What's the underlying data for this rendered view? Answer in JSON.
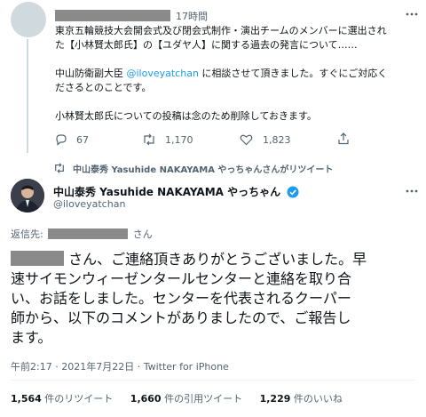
{
  "colors": {
    "accent": "#1d9bf0",
    "verified": "#1d9bf0",
    "text": "#0f1419",
    "secondary": "#536471",
    "redaction": "#8a8a8a"
  },
  "quoted_tweet": {
    "time": "17時間",
    "body_line1": "東京五輪競技大会開会式及び閉会式制作・演出チームのメンバーに選出され",
    "body_line2": "た【小林賢太郎氏】の【ユダヤ人】に関する過去の発言について……",
    "body_line3_before": "中山防衛副大臣",
    "body_line3_mention": "@iloveyatchan",
    "body_line3_after": "に相談させて頂きました。すぐにご対応く",
    "body_line4": "ださるとのことです。",
    "body_line5": "小林賢太郎氏についての投稿は念のため削除しておきます。",
    "replies": "67",
    "retweets": "1,170",
    "likes": "1,823",
    "menu_icon": "more-icon"
  },
  "retweet_notice": "中山泰秀 Yasuhide NAKAYAMA やっちゃんさんがリツイート",
  "author": {
    "display_name": "中山泰秀 Yasuhide NAKAYAMA やっちゃん",
    "handle": "@iloveyatchan",
    "verified": true
  },
  "reply_to_prefix": "返信先:",
  "reply_to_suffix": "さん",
  "tweet": {
    "line1": "さん、ご連絡頂きありがとうございました。早",
    "line2": "速サイモンウィーゼンタールセンターと連絡を取り合",
    "line3": "い、お話をしました。センターを代表されるクーパー",
    "line4": "師から、以下のコメントがありましたので、ご報告し",
    "line5": "ます。"
  },
  "meta": {
    "time": "午前2:17",
    "date": "2021年7月22日",
    "source": "Twitter for iPhone"
  },
  "stats": {
    "retweets_count": "1,564",
    "retweets_label": "件のリツイート",
    "quotes_count": "1,660",
    "quotes_label": "件の引用ツイート",
    "likes_count": "1,229",
    "likes_label": "件のいいね"
  }
}
